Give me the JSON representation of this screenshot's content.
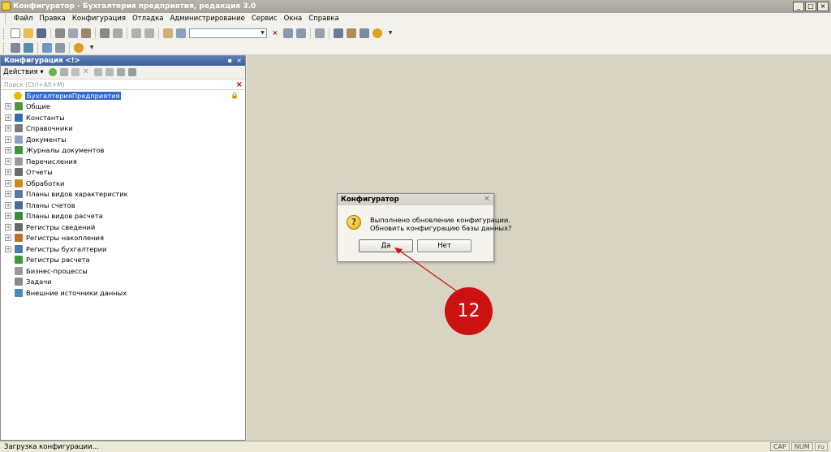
{
  "window": {
    "title": "Конфигуратор - Бухгалтерия предприятия, редакция 3.0",
    "controls": [
      "_",
      "□",
      "×"
    ]
  },
  "menu": [
    "Файл",
    "Правка",
    "Конфигурация",
    "Отладка",
    "Администрирование",
    "Сервис",
    "Окна",
    "Справка"
  ],
  "panel": {
    "title": "Конфигурация <!>",
    "actions_label": "Действия",
    "search_placeholder": "Поиск (Ctrl+Alt+M)",
    "tree": [
      {
        "label": "БухгалтерияПредприятия",
        "icon": "config-root-icon",
        "color": "#e8b800",
        "root": true
      },
      {
        "label": "Общие",
        "icon": "common-icon",
        "color": "#4a9a3a",
        "expandable": true
      },
      {
        "label": "Константы",
        "icon": "constants-icon",
        "color": "#2f6fb5",
        "expandable": true
      },
      {
        "label": "Справочники",
        "icon": "catalogs-icon",
        "color": "#7a7a7a",
        "expandable": true
      },
      {
        "label": "Документы",
        "icon": "documents-icon",
        "color": "#8aa0c0",
        "expandable": true
      },
      {
        "label": "Журналы документов",
        "icon": "document-journals-icon",
        "color": "#3a9a3a",
        "expandable": true
      },
      {
        "label": "Перечисления",
        "icon": "enums-icon",
        "color": "#9a9a9a",
        "expandable": true
      },
      {
        "label": "Отчеты",
        "icon": "reports-icon",
        "color": "#6a6a6a",
        "expandable": true
      },
      {
        "label": "Обработки",
        "icon": "data-processors-icon",
        "color": "#d08a20",
        "expandable": true
      },
      {
        "label": "Планы видов характеристик",
        "icon": "chart-of-characteristic-types-icon",
        "color": "#5a7aa0",
        "expandable": true
      },
      {
        "label": "Планы счетов",
        "icon": "chart-of-accounts-icon",
        "color": "#4a6a9a",
        "expandable": true
      },
      {
        "label": "Планы видов расчета",
        "icon": "chart-of-calculation-types-icon",
        "color": "#3a8a3a",
        "expandable": true
      },
      {
        "label": "Регистры сведений",
        "icon": "information-registers-icon",
        "color": "#6a6a6a",
        "expandable": true
      },
      {
        "label": "Регистры накопления",
        "icon": "accumulation-registers-icon",
        "color": "#c07020",
        "expandable": true
      },
      {
        "label": "Регистры бухгалтерии",
        "icon": "accounting-registers-icon",
        "color": "#4a7ab0",
        "expandable": true
      },
      {
        "label": "Регистры расчета",
        "icon": "calculation-registers-icon",
        "color": "#3a9a3a",
        "expandable": false
      },
      {
        "label": "Бизнес-процессы",
        "icon": "business-processes-icon",
        "color": "#9a9a9a",
        "expandable": false
      },
      {
        "label": "Задачи",
        "icon": "tasks-icon",
        "color": "#8a8a8a",
        "expandable": false
      },
      {
        "label": "Внешние источники данных",
        "icon": "external-data-sources-icon",
        "color": "#4a8ac0",
        "expandable": false
      }
    ]
  },
  "dialog": {
    "title": "Конфигуратор",
    "line1": "Выполнено обновление конфигурации.",
    "line2": "Обновить конфигурацию базы данных?",
    "yes": "Да",
    "no": "Нет",
    "icon": "question-icon"
  },
  "annotation": {
    "step": "12",
    "color": "#cc1111"
  },
  "status": {
    "text": "Загрузка конфигурации...",
    "indicators": [
      "CAP",
      "NUM",
      "ru"
    ]
  }
}
